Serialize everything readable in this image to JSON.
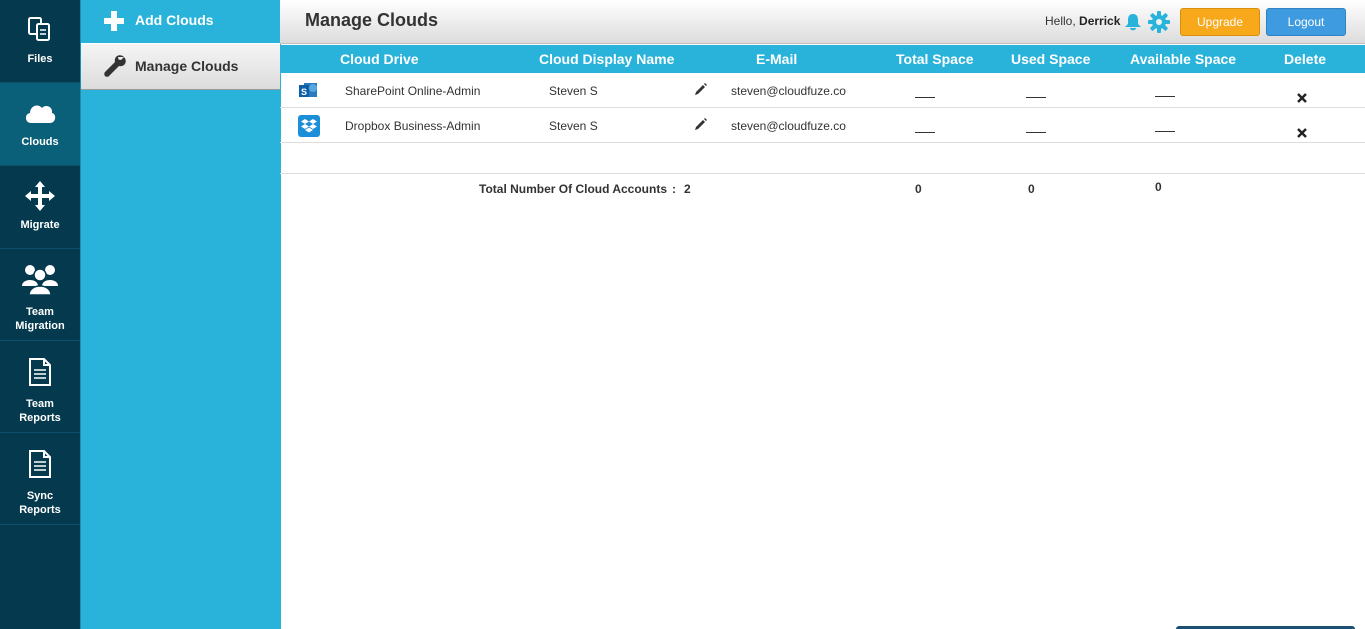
{
  "leftnav": {
    "items": [
      {
        "label": "Files",
        "icon": "files-icon"
      },
      {
        "label": "Clouds",
        "icon": "cloud-icon"
      },
      {
        "label": "Migrate",
        "icon": "move-arrows-icon"
      },
      {
        "label": "Team\nMigration",
        "icon": "team-icon"
      },
      {
        "label": "Team\nReports",
        "icon": "document-icon"
      },
      {
        "label": "Sync\nReports",
        "icon": "document-icon"
      }
    ]
  },
  "subnav": {
    "add_label": "Add Clouds",
    "manage_label": "Manage Clouds"
  },
  "header": {
    "title": "Manage Clouds",
    "hello_prefix": "Hello,",
    "user_name": "Derrick",
    "upgrade_label": "Upgrade",
    "logout_label": "Logout"
  },
  "table": {
    "columns": [
      "Cloud Drive",
      "Cloud Display Name",
      "E-Mail",
      "Total Space",
      "Used Space",
      "Available Space",
      "Delete"
    ],
    "rows": [
      {
        "icon": "sharepoint-icon",
        "drive": "SharePoint Online-Admin",
        "display_name": "Steven S",
        "email": "steven@cloudfuze.co"
      },
      {
        "icon": "dropbox-icon",
        "drive": "Dropbox Business-Admin",
        "display_name": "Steven S",
        "email": "steven@cloudfuze.co"
      }
    ],
    "totals": {
      "label": "Total Number Of Cloud Accounts",
      "colon": ":",
      "count": "2",
      "total_space": "0",
      "used_space": "0",
      "available_space": "0"
    }
  },
  "colors": {
    "nav_bg": "#053a4e",
    "accent": "#29b3da",
    "upgrade": "#f7a81b",
    "logout": "#3f9be0"
  }
}
